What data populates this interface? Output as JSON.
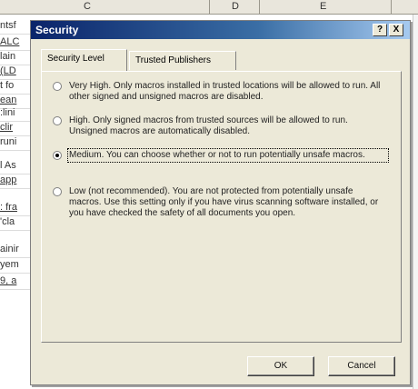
{
  "sheet": {
    "columns": [
      "C",
      "D",
      "E"
    ],
    "row_fragments": [
      {
        "text": "ntsf",
        "link": false
      },
      {
        "text": "ALC",
        "link": true
      },
      {
        "text": "lain",
        "link": false
      },
      {
        "text": "(LD",
        "link": true
      },
      {
        "text": "t fo",
        "link": false
      },
      {
        "text": "ean",
        "link": true
      },
      {
        "text": ":lini",
        "link": false
      },
      {
        "text": "clir",
        "link": true
      },
      {
        "text": "runi",
        "link": false
      },
      {
        "text": "l As",
        "link": false
      },
      {
        "text": "app",
        "link": true
      },
      {
        "text": ": fra",
        "link": true
      },
      {
        "text": "'cla",
        "link": false
      },
      {
        "text": "ainir",
        "link": false
      },
      {
        "text": "yem",
        "link": false
      },
      {
        "text": "9, a",
        "link": true
      }
    ]
  },
  "dialog": {
    "title": "Security",
    "help_label": "?",
    "close_label": "X",
    "tabs": [
      {
        "label": "Security Level",
        "active": true
      },
      {
        "label": "Trusted Publishers",
        "active": false
      }
    ],
    "options": [
      {
        "label": "Very High. Only macros installed in trusted locations will be allowed to run. All other signed and unsigned macros are disabled.",
        "selected": false
      },
      {
        "label": "High. Only signed macros from trusted sources will be allowed to run. Unsigned macros are automatically disabled.",
        "selected": false
      },
      {
        "label": "Medium. You can choose whether or not to run potentially unsafe macros.",
        "selected": true
      },
      {
        "label": "Low (not recommended). You are not protected from potentially unsafe macros. Use this setting only if you have virus scanning software installed, or you have checked the safety of all documents you open.",
        "selected": false
      }
    ],
    "ok_label": "OK",
    "cancel_label": "Cancel"
  }
}
